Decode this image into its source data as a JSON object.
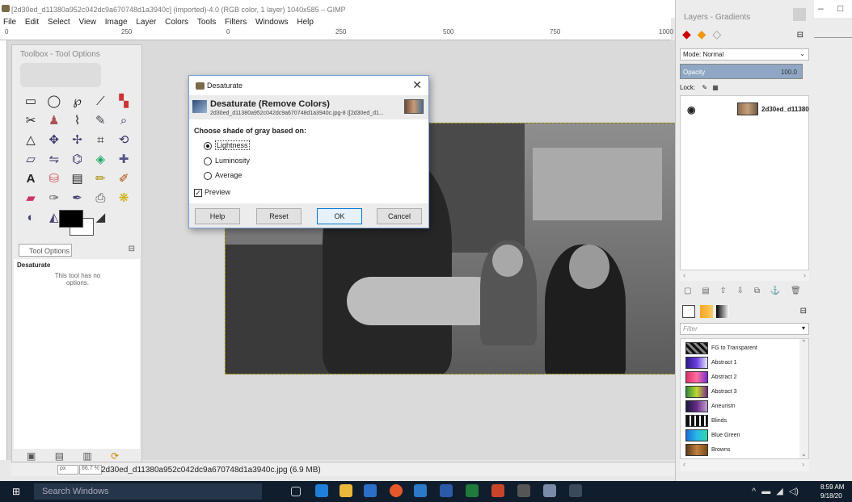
{
  "window": {
    "title": "[2d30ed_d11380a952c042dc9a670748d1a3940c] (imported)-4.0 (RGB color, 1 layer) 1040x585 – GIMP",
    "controls": [
      "–",
      "□"
    ]
  },
  "menu": [
    "File",
    "Edit",
    "Select",
    "View",
    "Image",
    "Layer",
    "Colors",
    "Tools",
    "Filters",
    "Windows",
    "Help"
  ],
  "ruler_ticks": [
    "0",
    "250",
    "0",
    "250",
    "500",
    "750",
    "1000"
  ],
  "toolbox": {
    "title": "Toolbox - Tool Options",
    "tool_options_tab": "Tool Options",
    "tool_name": "Desaturate",
    "no_options": "This tool has no options."
  },
  "status": {
    "unit": "px",
    "zoom": "66.7 %",
    "file": "2d30ed_d11380a952c042dc9a670748d1a3940c.jpg (6.9 MB)"
  },
  "dialog": {
    "title": "Desaturate",
    "close": "✕",
    "heading": "Desaturate (Remove Colors)",
    "subheading": "2d30ed_d11380a952c042dc9a670748d1a3940c.jpg-8 ([2d30ed_d1...",
    "section_label": "Choose shade of gray based on:",
    "options": [
      "Lightness",
      "Luminosity",
      "Average"
    ],
    "selected_option": "Lightness",
    "preview_label": "Preview",
    "preview_checked": true,
    "buttons": {
      "help": "Help",
      "reset": "Reset",
      "ok": "OK",
      "cancel": "Cancel"
    }
  },
  "dock": {
    "title": "Layers - Gradients",
    "mode": "Mode: Normal",
    "opacity_label": "Opacity",
    "opacity_value": "100.0",
    "lock_label": "Lock:",
    "layer_name": "2d30ed_d11380",
    "filter_placeholder": "Filter",
    "gradients": [
      {
        "name": "FG to Transparent",
        "color": "#111111"
      },
      {
        "name": "Abstract 1",
        "color": "#4a3fbf"
      },
      {
        "name": "Abstract 2",
        "color": "#e0306a"
      },
      {
        "name": "Abstract 3",
        "color": "#2c8a3c"
      },
      {
        "name": "Aneurism",
        "color": "#6a2a8a"
      },
      {
        "name": "Blinds",
        "color": "#222222"
      },
      {
        "name": "Blue Green",
        "color": "#2aa8d8"
      },
      {
        "name": "Browns",
        "color": "#8a5a2a"
      }
    ]
  },
  "taskbar": {
    "search_placeholder": "Search Windows",
    "time": "8:59 AM",
    "date": "9/18/20"
  }
}
